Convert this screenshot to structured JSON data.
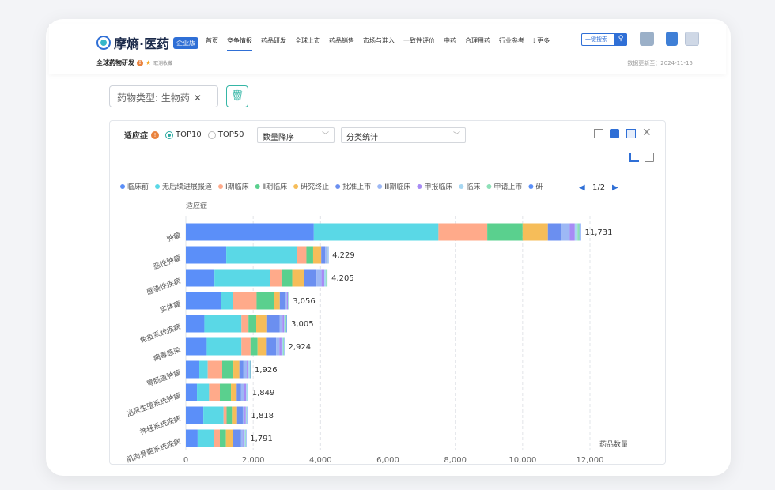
{
  "app": {
    "logo_text": "摩熵·医药",
    "logo_badge": "企业版",
    "nav": [
      "首页",
      "竞争情报",
      "药品研发",
      "全球上市",
      "药品销售",
      "市场与准入",
      "一致性评价",
      "中药",
      "合理用药",
      "行业参考",
      "更多"
    ],
    "nav_active_index": 1,
    "search_label": "一键搜索",
    "page_title": "全球药物研发",
    "favorite_label": "取消收藏",
    "updated": "数据更新至：2024-11-15"
  },
  "filters": {
    "chip_label": "药物类型: 生物药",
    "chip_close": "✕"
  },
  "panel": {
    "dimension_label": "适应症",
    "radio_options": [
      "TOP10",
      "TOP50"
    ],
    "radio_selected": "TOP10",
    "sort_select": "数量降序",
    "stat_select": "分类统计",
    "pager": "1/2"
  },
  "chart_data": {
    "type": "bar",
    "orientation": "horizontal",
    "stacked": true,
    "ylabel": "适应症",
    "xlabel": "药品数量",
    "xlim": [
      0,
      12000
    ],
    "xticks": [
      0,
      2000,
      4000,
      6000,
      8000,
      10000,
      12000
    ],
    "xtick_labels": [
      "0",
      "2,000",
      "4,000",
      "6,000",
      "8,000",
      "10,000",
      "12,000"
    ],
    "categories": [
      "肿瘤",
      "恶性肿瘤",
      "感染性疾病",
      "实体瘤",
      "免疫系统疾病",
      "病毒感染",
      "胃肠道肿瘤",
      "泌尿生殖系统肿瘤",
      "神经系统疾病",
      "肌肉骨骼系统疾病"
    ],
    "totals": [
      11731,
      4229,
      4205,
      3056,
      3005,
      2924,
      1926,
      1849,
      1818,
      1791
    ],
    "total_labels": [
      "11,731",
      "4,229",
      "4,205",
      "3,056",
      "3,005",
      "2,924",
      "1,926",
      "1,849",
      "1,818",
      "1,791"
    ],
    "series": [
      {
        "name": "临床前",
        "color": "#5b8ff9",
        "values": [
          3800,
          1200,
          850,
          1050,
          550,
          620,
          400,
          330,
          520,
          350
        ]
      },
      {
        "name": "无后续进展报道",
        "color": "#5ad8e6",
        "values": [
          3700,
          2100,
          1650,
          350,
          1100,
          1030,
          250,
          360,
          600,
          480
        ]
      },
      {
        "name": "Ⅰ期临床",
        "color": "#ffaa8a",
        "values": [
          1450,
          280,
          340,
          700,
          210,
          270,
          430,
          320,
          90,
          180
        ]
      },
      {
        "name": "Ⅱ期临床",
        "color": "#5ad08e",
        "values": [
          1050,
          200,
          320,
          520,
          230,
          210,
          330,
          330,
          160,
          180
        ]
      },
      {
        "name": "研究终止",
        "color": "#f6bd59",
        "values": [
          750,
          240,
          340,
          170,
          300,
          250,
          180,
          170,
          150,
          200
        ]
      },
      {
        "name": "批准上市",
        "color": "#6b8ff0",
        "values": [
          400,
          120,
          380,
          160,
          400,
          300,
          120,
          130,
          170,
          250
        ]
      },
      {
        "name": "Ⅲ期临床",
        "color": "#9db8f5",
        "values": [
          250,
          40,
          150,
          50,
          80,
          100,
          100,
          90,
          50,
          60
        ]
      },
      {
        "name": "申报临床",
        "color": "#a78bf5",
        "values": [
          150,
          30,
          80,
          30,
          50,
          60,
          50,
          60,
          40,
          40
        ]
      },
      {
        "name": "临床",
        "color": "#a7d7f2",
        "values": [
          80,
          10,
          50,
          15,
          40,
          50,
          40,
          40,
          20,
          30
        ]
      },
      {
        "name": "申请上市",
        "color": "#8ee0b8",
        "values": [
          60,
          5,
          30,
          8,
          30,
          24,
          16,
          12,
          10,
          15
        ]
      },
      {
        "name": "研",
        "color": "#5b8ff9",
        "values": [
          41,
          4,
          15,
          3,
          15,
          10,
          10,
          7,
          8,
          6
        ]
      }
    ],
    "legend_position": "top",
    "grid": "vertical-dashed"
  }
}
